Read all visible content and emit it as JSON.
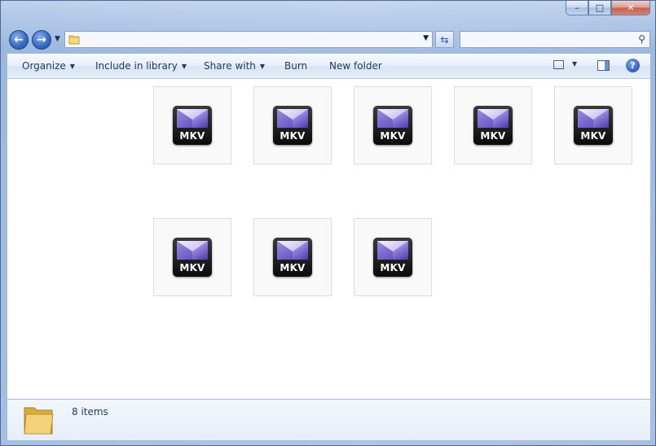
{
  "window": {
    "caption_buttons": [
      {
        "name": "minimize-button",
        "glyph": "–"
      },
      {
        "name": "maximize-button",
        "glyph": "□"
      },
      {
        "name": "close-button",
        "glyph": "✕"
      }
    ]
  },
  "navigation": {
    "back_icon": "back-arrow-icon",
    "forward_icon": "forward-arrow-icon",
    "address_value": "",
    "search_value": "",
    "search_icon": "search-icon"
  },
  "toolbar": {
    "items": [
      {
        "label": "Organize",
        "dropdown": true
      },
      {
        "label": "Include in library",
        "dropdown": true
      },
      {
        "label": "Share with",
        "dropdown": true
      },
      {
        "label": "Burn",
        "dropdown": false
      },
      {
        "label": "New folder",
        "dropdown": false
      }
    ],
    "help_glyph": "?"
  },
  "files": [
    {
      "type_label": "MKV"
    },
    {
      "type_label": "MKV"
    },
    {
      "type_label": "MKV"
    },
    {
      "type_label": "MKV"
    },
    {
      "type_label": "MKV"
    },
    {
      "type_label": "MKV"
    },
    {
      "type_label": "MKV"
    },
    {
      "type_label": "MKV"
    }
  ],
  "details": {
    "item_count": "8 items"
  },
  "colors": {
    "accent": "#1e395b",
    "frame": "#a0bbe1",
    "icon_purple": "#8a78d8"
  }
}
